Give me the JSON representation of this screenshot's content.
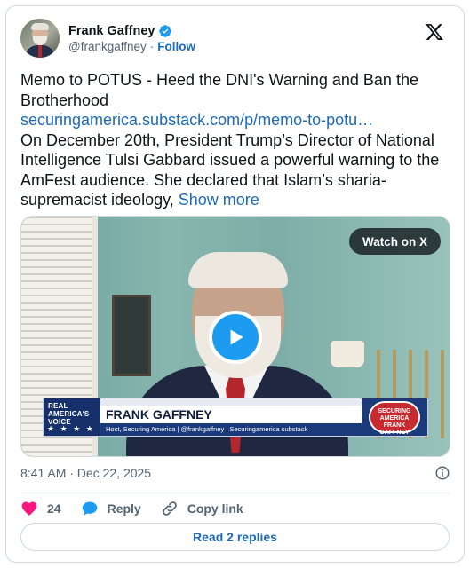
{
  "author": {
    "name": "Frank Gaffney",
    "handle": "@frankgaffney",
    "separator": "·",
    "follow_label": "Follow"
  },
  "post": {
    "headline": "Memo to POTUS - Heed the DNI's Warning and Ban the Brotherhood",
    "link_text": "securingamerica.substack.com/p/memo-to-potu…",
    "body": "On December 20th, President Trump’s Director of National Intelligence Tulsi Gabbard issued a powerful warning to the AmFest audience. She declared that Islam’s sharia-supremacist ideology,",
    "show_more": "Show more"
  },
  "video": {
    "watch_label": "Watch on X",
    "lower_third": {
      "network": "REAL AMERICA'S VOICE",
      "stars": "★ ★ ★ ★",
      "name": "FRANK GAFFNEY",
      "subtitle": "Host, Securing America | @frankgaffney | Securingamerica substack",
      "badge": "SECURING AMERICA FRANK GAFFNEY"
    }
  },
  "meta": {
    "timestamp": "8:41 AM · Dec 22, 2025"
  },
  "actions": {
    "likes": "24",
    "reply_label": "Reply",
    "copy_label": "Copy link"
  },
  "read_replies_label": "Read 2 replies",
  "colors": {
    "link": "#1d6ab9",
    "verified": "#1d9bf0",
    "like": "#f91880",
    "reply_icon": "#1d9bf0"
  },
  "icons": [
    "verified-badge-icon",
    "x-logo-icon",
    "play-icon",
    "info-icon",
    "heart-icon",
    "reply-bubble-icon",
    "link-icon"
  ]
}
